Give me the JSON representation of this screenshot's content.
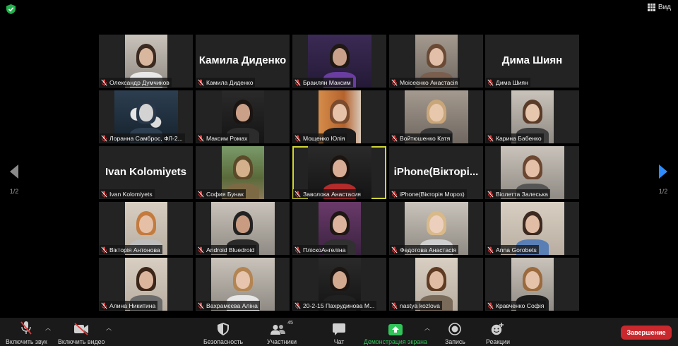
{
  "topbar": {
    "view_label": "Вид"
  },
  "navigation": {
    "page_left": "1/2",
    "page_right": "1/2"
  },
  "participants": [
    {
      "name": "Олександр Думчиков",
      "video": true,
      "scene": "room-light",
      "skin": "#d9b79f",
      "hair": "#3a2a20",
      "shirt": "#e8e8e8"
    },
    {
      "name": "Камила Диденко",
      "video": false,
      "display_name": "Камила Диденко"
    },
    {
      "name": "Браилян Максим",
      "video": true,
      "scene": "purple",
      "skin": "#c9a08a",
      "hair": "#1f1814",
      "shirt": "#6a3ea1"
    },
    {
      "name": "Моісеєнко Анастасія",
      "video": true,
      "scene": "ceiling",
      "skin": "#e2bfa8",
      "hair": "#6b4a35",
      "shirt": "#7a5f4f"
    },
    {
      "name": "Дима Шиян",
      "video": false,
      "display_name": "Дима Шиян"
    },
    {
      "name": "Лоранна Самброс, ФЛ-2...",
      "video": true,
      "scene": "dandelion",
      "skin": "#d3d3d3",
      "hair": "#28384a",
      "shirt": "#2f3f52"
    },
    {
      "name": "Максим Ромах",
      "video": true,
      "scene": "dark",
      "skin": "#caa088",
      "hair": "#1a1412",
      "shirt": "#2c2c2c"
    },
    {
      "name": "Мощенко Юлія",
      "video": true,
      "scene": "orange",
      "skin": "#e6c2a8",
      "hair": "#7b4b2e",
      "shirt": "#1c1c1c"
    },
    {
      "name": "Войтюшенко Катя",
      "video": true,
      "scene": "ceiling",
      "skin": "#e8c8ad",
      "hair": "#c9a67a",
      "shirt": "#3a3a3a"
    },
    {
      "name": "Карина Бабенко",
      "video": true,
      "scene": "room-light",
      "skin": "#e7c6ae",
      "hair": "#5a3b28",
      "shirt": "#3f3f3f"
    },
    {
      "name": "Ivan Kolomiyets",
      "video": false,
      "display_name": "Ivan Kolomiyets"
    },
    {
      "name": "София Бунак",
      "video": true,
      "scene": "tree",
      "skin": "#d4b08c",
      "hair": "#5b4a2a",
      "shirt": "#7d6a45"
    },
    {
      "name": "Заволока Анастасия",
      "video": true,
      "scene": "dark",
      "skin": "#d9ad95",
      "hair": "#1b1411",
      "shirt": "#b42b2b",
      "active": true
    },
    {
      "name": "iPhone(Вікторія Мороз)",
      "video": false,
      "display_name": "iPhone(Вікторі..."
    },
    {
      "name": "Віолетта Залеська",
      "video": true,
      "scene": "room-light",
      "skin": "#e4c0a8",
      "hair": "#6b4630",
      "shirt": "#555"
    },
    {
      "name": "Вікторія Антонова",
      "video": true,
      "scene": "wall",
      "skin": "#e5c0a7",
      "hair": "#c47b3e",
      "shirt": "#bdbdbd"
    },
    {
      "name": "Android Bluedroid",
      "video": true,
      "scene": "room-light",
      "skin": "#c99c82",
      "hair": "#222",
      "shirt": "#2a2a2a"
    },
    {
      "name": "ПліскоАнгеліна",
      "video": true,
      "scene": "pink",
      "skin": "#dcb39c",
      "hair": "#1e1714",
      "shirt": "#303030"
    },
    {
      "name": "Федотова Анастасія",
      "video": true,
      "scene": "room-light",
      "skin": "#ecd0bd",
      "hair": "#d8b98a",
      "shirt": "#cfcfcf"
    },
    {
      "name": "Anna Gorobets",
      "video": true,
      "scene": "wall",
      "skin": "#e2bda5",
      "hair": "#3c2a20",
      "shirt": "#5a7fb5"
    },
    {
      "name": "Алина Никитина",
      "video": true,
      "scene": "wall",
      "skin": "#dcb59d",
      "hair": "#3b2619",
      "shirt": "#6b6b6b"
    },
    {
      "name": "Вахрамєєва Аліна",
      "video": true,
      "scene": "room-light",
      "skin": "#e6c4ad",
      "hair": "#b38552",
      "shirt": "#e6e6e6"
    },
    {
      "name": "20-2-15 Пахрудинова М...",
      "video": true,
      "scene": "dark",
      "skin": "#d2a88f",
      "hair": "#1c1512",
      "shirt": "#202020"
    },
    {
      "name": "nastya kozlova",
      "video": true,
      "scene": "wall",
      "skin": "#e1bca4",
      "hair": "#5e3b22",
      "shirt": "#7a6a5a"
    },
    {
      "name": "Кравченко Софія",
      "video": true,
      "scene": "room-light",
      "skin": "#e5c3aa",
      "hair": "#9b6a3d",
      "shirt": "#1c1c1c"
    }
  ],
  "toolbar": {
    "unmute_label": "Включить звук",
    "start_video_label": "Включить видео",
    "security_label": "Безопасность",
    "participants_label": "Участники",
    "participants_count": "45",
    "chat_label": "Чат",
    "share_label": "Демонстрация экрана",
    "record_label": "Запись",
    "reactions_label": "Реакции",
    "end_label": "Завершение"
  },
  "colors": {
    "active_speaker": "#cfd435",
    "share_green": "#32c45a",
    "end_red": "#c9282d",
    "tile_bg": "#232323"
  }
}
